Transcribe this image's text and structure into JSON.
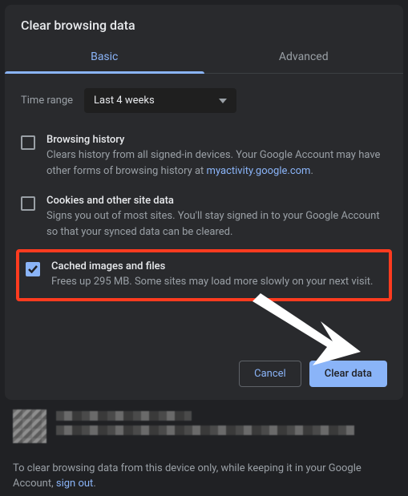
{
  "dialog": {
    "title": "Clear browsing data",
    "tabs": {
      "basic": "Basic",
      "advanced": "Advanced"
    },
    "time_range_label": "Time range",
    "time_range_value": "Last 4 weeks",
    "options": [
      {
        "title": "Browsing history",
        "desc_pre": "Clears history from all signed-in devices. Your Google Account may have other forms of browsing history at ",
        "link": "myactivity.google.com",
        "desc_post": ".",
        "checked": false
      },
      {
        "title": "Cookies and other site data",
        "desc": "Signs you out of most sites. You'll stay signed in to your Google Account so that your synced data can be cleared.",
        "checked": false
      },
      {
        "title": "Cached images and files",
        "desc": "Frees up 295 MB. Some sites may load more slowly on your next visit.",
        "checked": true
      }
    ],
    "buttons": {
      "cancel": "Cancel",
      "clear": "Clear data"
    }
  },
  "footer": {
    "text_pre": "To clear browsing data from this device only, while keeping it in your Google Account, ",
    "link": "sign out",
    "text_post": "."
  }
}
